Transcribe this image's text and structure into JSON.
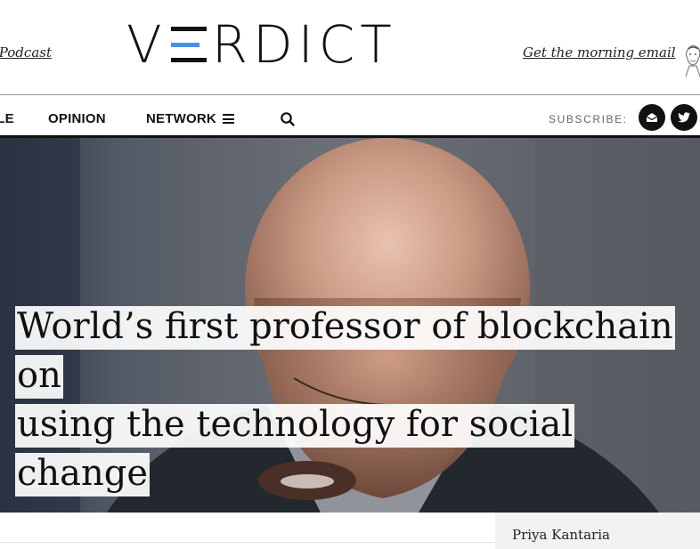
{
  "header": {
    "podcast_link": "t Podcast",
    "logo_letters_left": "V",
    "logo_letters_right": "RDICT",
    "email_link": "Get the morning email"
  },
  "nav": {
    "items": [
      "YLE",
      "OPINION",
      "NETWORK"
    ],
    "subscribe_label": "SUBSCRIBE:",
    "icons": [
      "hamburger-icon",
      "search-icon",
      "newsletter-icon",
      "twitter-icon"
    ]
  },
  "article": {
    "headline_line1": "World’s first professor of blockchain on",
    "headline_line2": "using the technology for social change",
    "author": "Priya Kantaria"
  },
  "colors": {
    "logo_accent": "#4a90e2",
    "nav_rule": "#111111",
    "social_bg": "#111111"
  }
}
